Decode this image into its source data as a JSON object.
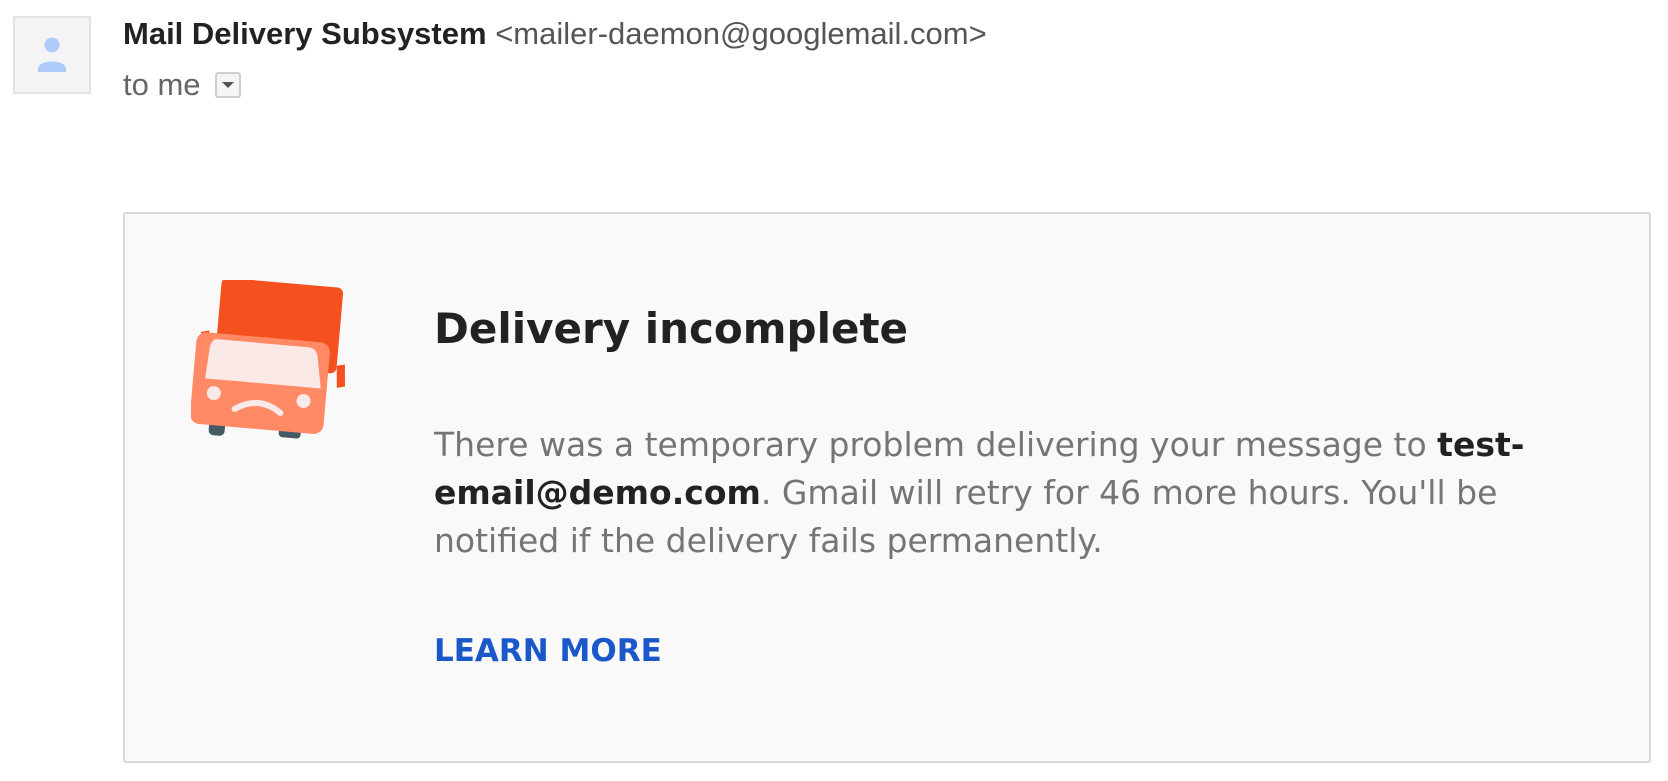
{
  "header": {
    "sender_name": "Mail Delivery Subsystem",
    "sender_email": "<mailer-daemon@googlemail.com>",
    "recipient_label": "to me"
  },
  "notice": {
    "title": "Delivery incomplete",
    "body_before": "There was a temporary problem delivering your message to ",
    "recipient_email": "test-email@demo.com",
    "body_after": ". Gmail will retry for 46 more hours. You'll be notified if the delivery fails permanently.",
    "learn_more_label": "LEARN MORE"
  },
  "icons": {
    "avatar": "person-icon",
    "details_toggle": "dropdown-arrow-icon",
    "illustration": "sad-truck-icon"
  },
  "colors": {
    "link": "#1a57c8",
    "truck_cab": "#f4511e",
    "truck_front": "#ff8a65",
    "avatar_person": "#aecbfa"
  }
}
